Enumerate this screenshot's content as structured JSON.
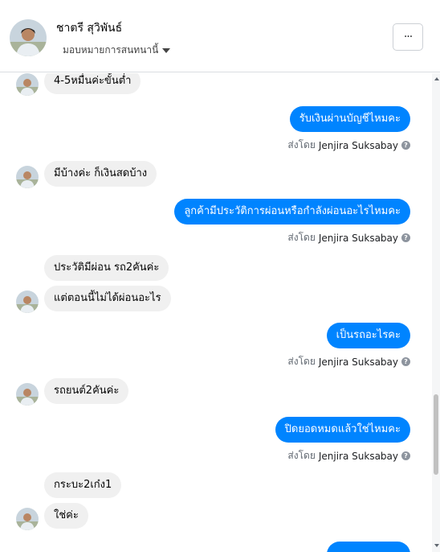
{
  "header": {
    "contact_name": "ชาตรี สุวิพันธ์",
    "assign_label": "มอบหมายการสนทนานี้",
    "more_label": "···"
  },
  "colors": {
    "outgoing_bubble": "#0084ff",
    "incoming_bubble": "#f0f0f0"
  },
  "messages": [
    {
      "dir": "in",
      "text": "4-5หมื่นค่ะขั้นต่ำ"
    },
    {
      "dir": "out",
      "text": "รับเงินผ่านบัญชีไหมคะ",
      "sent_prefix": "ส่งโดย",
      "sent_by": "Jenjira Suksabay"
    },
    {
      "dir": "in",
      "text": "มีบ้างค่ะ ก็เงินสดบ้าง"
    },
    {
      "dir": "out",
      "text": "ลูกค้ามีประวัติการผ่อนหรือกำลังผ่อนอะไรไหมคะ",
      "sent_prefix": "ส่งโดย",
      "sent_by": "Jenjira Suksabay"
    },
    {
      "dir": "in",
      "text": "ประวัติมีผ่อน รถ2คันค่ะ"
    },
    {
      "dir": "in",
      "text": "แต่ตอนนี้ไม่ได้ผ่อนอะไร"
    },
    {
      "dir": "out",
      "text": "เป็นรถอะไรคะ",
      "sent_prefix": "ส่งโดย",
      "sent_by": "Jenjira Suksabay"
    },
    {
      "dir": "in",
      "text": "รถยนต์2คันค่ะ"
    },
    {
      "dir": "out",
      "text": "ปิดยอดหมดแล้วใช่ไหมคะ",
      "sent_prefix": "ส่งโดย",
      "sent_by": "Jenjira Suksabay"
    },
    {
      "dir": "in",
      "text": "กระบะ2เก๋ง1"
    },
    {
      "dir": "in",
      "text": "ใช่ค่ะ"
    }
  ]
}
